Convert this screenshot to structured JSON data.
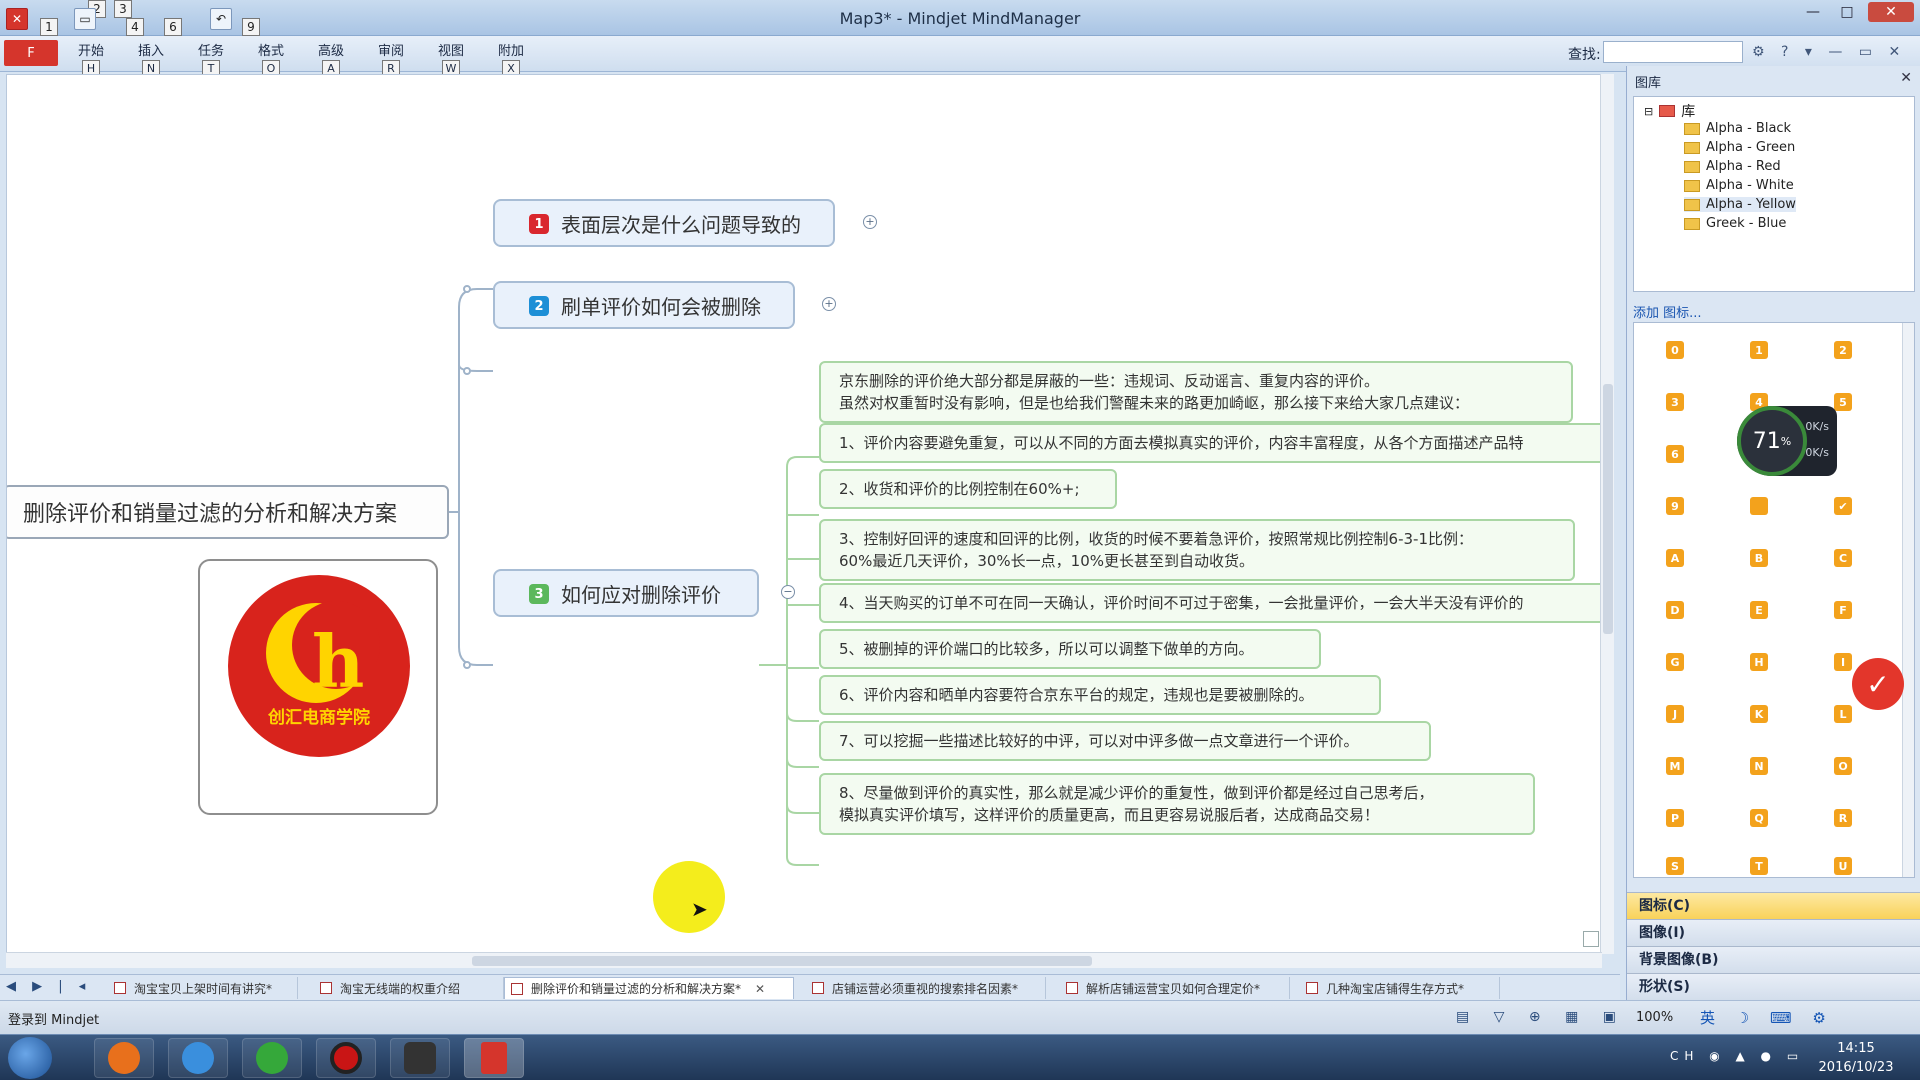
{
  "window": {
    "title": "Map3* - Mindjet MindManager",
    "qat_keys": [
      "1",
      "2",
      "3",
      "4",
      "6",
      "9"
    ],
    "controls": [
      "—",
      "□",
      "✕"
    ]
  },
  "ribbon": {
    "file_tab": "F",
    "tabs": [
      {
        "label": "开始",
        "key": "H"
      },
      {
        "label": "插入",
        "key": "N"
      },
      {
        "label": "任务",
        "key": "T"
      },
      {
        "label": "格式",
        "key": "O"
      },
      {
        "label": "高级",
        "key": "A"
      },
      {
        "label": "审阅",
        "key": "R"
      },
      {
        "label": "视图",
        "key": "W"
      },
      {
        "label": "附加",
        "key": "X"
      }
    ],
    "find_label": "查找:",
    "find_value": ""
  },
  "map": {
    "central_topic": "删除评价和销量过滤的分析和解决方案",
    "logo_text": "创汇电商学院",
    "topics": [
      {
        "number": "1",
        "label": "表面层次是什么问题导致的",
        "color": "#d9272e",
        "expander": "+"
      },
      {
        "number": "2",
        "label": "刷单评价如何会被删除",
        "color": "#1d8fd6",
        "expander": "+"
      },
      {
        "number": "3",
        "label": "如何应对删除评价",
        "color": "#5cb85c",
        "expander": "−"
      }
    ],
    "subtopics": [
      {
        "line1": "京东删除的评价绝大部分都是屏蔽的一些：违规词、反动谣言、重复内容的评价。",
        "line2": "虽然对权重暂时没有影响，但是也给我们警醒未来的路更加崎岖，那么接下来给大家几点建议："
      },
      {
        "line1": "1、评价内容要避免重复，可以从不同的方面去模拟真实的评价，内容丰富程度，从各个方面描述产品特",
        "line2": ""
      },
      {
        "line1": "2、收货和评价的比例控制在60%+;",
        "line2": ""
      },
      {
        "line1": "3、控制好回评的速度和回评的比例，收货的时候不要着急评价，按照常规比例控制6-3-1比例：",
        "line2": "60%最近几天评价，30%长一点，10%更长甚至到自动收货。"
      },
      {
        "line1": "4、当天购买的订单不可在同一天确认，评价时间不可过于密集，一会批量评价，一会大半天没有评价的",
        "line2": ""
      },
      {
        "line1": "5、被删掉的评价端口的比较多，所以可以调整下做单的方向。",
        "line2": ""
      },
      {
        "line1": "6、评价内容和晒单内容要符合京东平台的规定，违规也是要被删除的。",
        "line2": ""
      },
      {
        "line1": "7、可以挖掘一些描述比较好的中评，可以对中评多做一点文章进行一个评价。",
        "line2": ""
      },
      {
        "line1": "8、尽量做到评价的真实性，那么就是减少评价的重复性，做到评价都是经过自己思考后，",
        "line2": "模拟真实评价填写，这样评价的质量更高，而且更容易说服后者，达成商品交易！"
      }
    ]
  },
  "panel": {
    "title": "图库",
    "library_root": "库",
    "library_items": [
      "Alpha - Black",
      "Alpha - Green",
      "Alpha - Red",
      "Alpha - White",
      "Alpha - Yellow",
      "Greek - Blue"
    ],
    "selected_item": "Alpha - Yellow",
    "add_icon_link": "添加 图标...",
    "icons": [
      "0",
      "1",
      "2",
      "3",
      "4",
      "5",
      "6",
      "",
      "",
      "9",
      "",
      "✔",
      "A",
      "B",
      "C",
      "D",
      "E",
      "F",
      "G",
      "H",
      "I",
      "J",
      "K",
      "L",
      "M",
      "N",
      "O",
      "P",
      "Q",
      "R",
      "S",
      "T",
      "U"
    ],
    "speed_widget": {
      "percent": "71",
      "unit": "%",
      "up": "0K/s",
      "down": "0K/s"
    },
    "sections": [
      "图标(C)",
      "图像(I)",
      "背景图像(B)",
      "形状(S)"
    ]
  },
  "doc_tabs": [
    {
      "label": "淘宝宝贝上架时间有讲究*",
      "active": false
    },
    {
      "label": "淘宝无线端的权重介绍",
      "active": false
    },
    {
      "label": "删除评价和销量过滤的分析和解决方案*",
      "active": true
    },
    {
      "label": "店铺运营必须重视的搜索排名因素*",
      "active": false
    },
    {
      "label": "解析店铺运营宝贝如何合理定价*",
      "active": false
    },
    {
      "label": "几种淘宝店铺得生存方式*",
      "active": false
    }
  ],
  "statusbar": {
    "login": "登录到 Mindjet",
    "zoom": "100%",
    "ime": "英"
  },
  "taskbar": {
    "tray_text": "CH",
    "time": "14:15",
    "date": "2016/10/23"
  }
}
